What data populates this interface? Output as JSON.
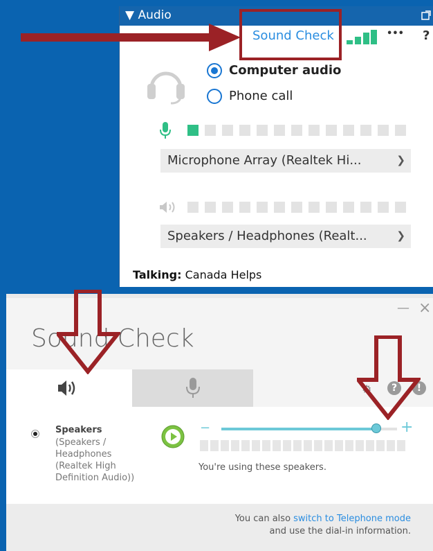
{
  "audio_panel": {
    "title": "Audio",
    "sound_check_link": "Sound Check",
    "more_label": "•••",
    "help_label": "?",
    "options": [
      {
        "label": "Computer audio",
        "selected": true
      },
      {
        "label": "Phone call",
        "selected": false
      }
    ],
    "microphone_select": "Microphone Array (Realtek Hi...",
    "speaker_select": "Speakers  /  Headphones  (Realt...",
    "talking_label": "Talking:",
    "talking_name": "Canada Helps",
    "mic_level_active_bars": 1,
    "accent_color": "#1565ad",
    "meter_color": "#2fbf86"
  },
  "sound_check": {
    "title": "Sound Check",
    "minimize_label": "—",
    "close_label": "×",
    "tabs": [
      {
        "name": "speaker-tab",
        "icon": "speaker-icon",
        "active": true
      },
      {
        "name": "microphone-tab",
        "icon": "microphone-icon",
        "active": false
      }
    ],
    "toolbar_help": "?",
    "toolbar_info": "!",
    "device": {
      "name": "Speakers",
      "detail": [
        "(Speakers /",
        "Headphones",
        "(Realtek High",
        "Definition Audio))"
      ]
    },
    "volume_minus": "−",
    "volume_plus": "+",
    "volume_level": 0.88,
    "status_text": "You're using these speakers.",
    "footer_prefix": "You can also ",
    "footer_link": "switch to Telephone mode",
    "footer_suffix": "and use the dial-in information."
  }
}
